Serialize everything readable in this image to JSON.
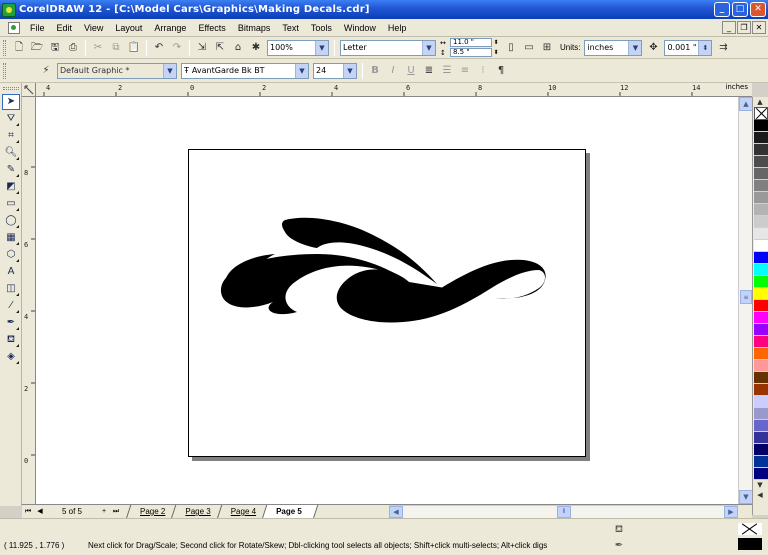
{
  "window": {
    "title": "CorelDRAW 12 - [C:\\Model Cars\\Graphics\\Making Decals.cdr]",
    "minimize": "_",
    "maximize": "□",
    "close": "✕"
  },
  "menu": {
    "items": [
      "File",
      "Edit",
      "View",
      "Layout",
      "Arrange",
      "Effects",
      "Bitmaps",
      "Text",
      "Tools",
      "Window",
      "Help"
    ]
  },
  "standard_toolbar": {
    "zoom_value": "100%",
    "paper_size": "Letter",
    "width_value": "11.0 \"",
    "height_value": "8.5 \"",
    "units_label": "Units:",
    "units_value": "inches",
    "nudge_value": "0.001 \""
  },
  "property_bar": {
    "style_value": "Default Graphic *",
    "font_value": "AvantGarde Bk BT",
    "font_size_value": "24"
  },
  "rulers": {
    "unit": "inches",
    "horizontal_labels": [
      "4",
      "2",
      "0",
      "2",
      "4",
      "6",
      "8",
      "10",
      "12",
      "14"
    ],
    "vertical_labels": [
      "8",
      "6",
      "4",
      "2",
      "0"
    ]
  },
  "page_nav": {
    "count_text": "5 of 5",
    "tabs": [
      "Page 2",
      "Page 3",
      "Page 4",
      "Page 5"
    ],
    "active_tab": "Page 5"
  },
  "status": {
    "coords": "( 11.925 , 1.776 )",
    "hint": "Next click for Drag/Scale; Second click for Rotate/Skew; Dbl-clicking tool selects all objects; Shift+click multi-selects; Alt+click digs"
  },
  "palette_colors": [
    "#000000",
    "#1a1a1a",
    "#333333",
    "#4d4d4d",
    "#666666",
    "#808080",
    "#999999",
    "#b3b3b3",
    "#cccccc",
    "#e6e6e6",
    "#ffffff",
    "#0000ff",
    "#00ffff",
    "#00ff00",
    "#ffff00",
    "#ff0000",
    "#ff00ff",
    "#9900ff",
    "#ff0080",
    "#ff6600",
    "#ff9999",
    "#663300",
    "#993300",
    "#ccccff",
    "#9999cc",
    "#6666cc",
    "#333399",
    "#000066",
    "#003399",
    "#000080"
  ]
}
